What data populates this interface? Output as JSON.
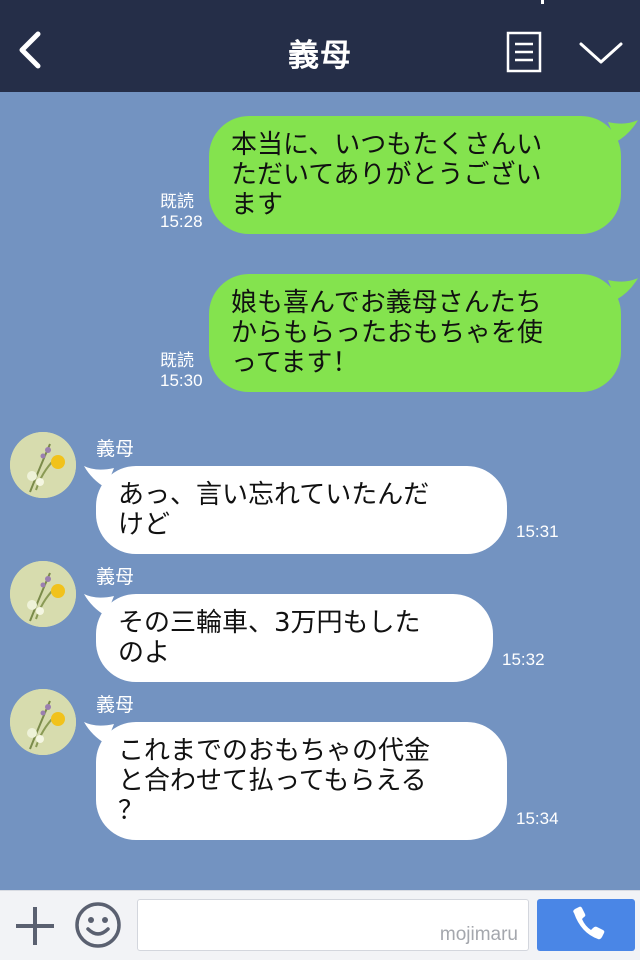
{
  "header": {
    "title": "義母",
    "back_icon": "chevron-left-icon",
    "menu_icon": "note-list-icon",
    "collapse_icon": "chevron-down-icon",
    "background": "#252e48"
  },
  "chat": {
    "background": "#7393c1",
    "outgoing_color": "#84e34e",
    "incoming_color": "#ffffff",
    "messages": [
      {
        "direction": "out",
        "text": "本当に、いつもたくさんい\nただいてありがとうござい\nます",
        "read_label": "既読",
        "time": "15:28"
      },
      {
        "direction": "out",
        "text": "娘も喜んでお義母さんたち\nからもらったおもちゃを使\nってます！",
        "read_label": "既読",
        "time": "15:30"
      },
      {
        "direction": "in",
        "sender": "義母",
        "text": "あっ、言い忘れていたんだ\nけど",
        "time": "15:31"
      },
      {
        "direction": "in",
        "sender": "義母",
        "text": "その三輪車、3万円もした\nのよ",
        "time": "15:32"
      },
      {
        "direction": "in",
        "sender": "義母",
        "text": "これまでのおもちゃの代金\nと合わせて払ってもらえる\n？",
        "time": "15:34"
      }
    ]
  },
  "input_bar": {
    "plus_icon": "plus-icon",
    "emoji_icon": "smiley-icon",
    "watermark": "mojimaru",
    "call_icon": "phone-icon",
    "call_color": "#4a86e6"
  }
}
